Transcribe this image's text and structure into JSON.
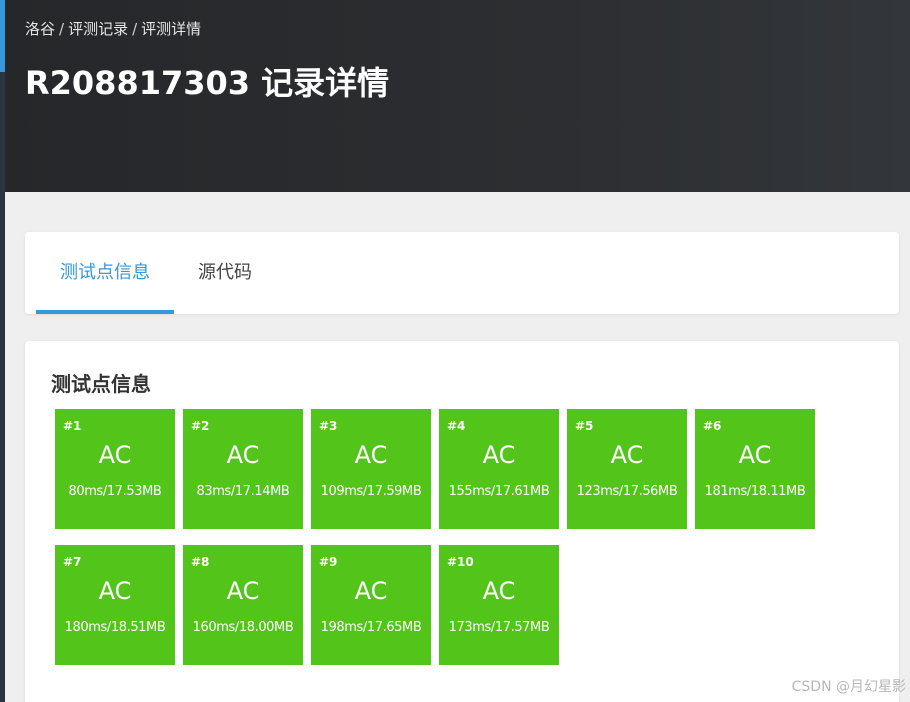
{
  "breadcrumb": {
    "items": [
      "洛谷",
      "评测记录",
      "评测详情"
    ],
    "separator": "/"
  },
  "header": {
    "title": "R208817303 记录详情"
  },
  "tabs": [
    {
      "label": "测试点信息",
      "active": true
    },
    {
      "label": "源代码",
      "active": false
    }
  ],
  "testcases": {
    "title": "测试点信息",
    "items": [
      {
        "id": "#1",
        "status": "AC",
        "stat": "80ms/17.53MB"
      },
      {
        "id": "#2",
        "status": "AC",
        "stat": "83ms/17.14MB"
      },
      {
        "id": "#3",
        "status": "AC",
        "stat": "109ms/17.59MB"
      },
      {
        "id": "#4",
        "status": "AC",
        "stat": "155ms/17.61MB"
      },
      {
        "id": "#5",
        "status": "AC",
        "stat": "123ms/17.56MB"
      },
      {
        "id": "#6",
        "status": "AC",
        "stat": "181ms/18.11MB"
      },
      {
        "id": "#7",
        "status": "AC",
        "stat": "180ms/18.51MB"
      },
      {
        "id": "#8",
        "status": "AC",
        "stat": "160ms/18.00MB"
      },
      {
        "id": "#9",
        "status": "AC",
        "stat": "198ms/17.65MB"
      },
      {
        "id": "#10",
        "status": "AC",
        "stat": "173ms/17.57MB"
      }
    ]
  },
  "watermark": "CSDN @月幻星影",
  "colors": {
    "accent": "#3498db",
    "ac_green": "#52c41a",
    "header_bg": "#2c2e31"
  }
}
